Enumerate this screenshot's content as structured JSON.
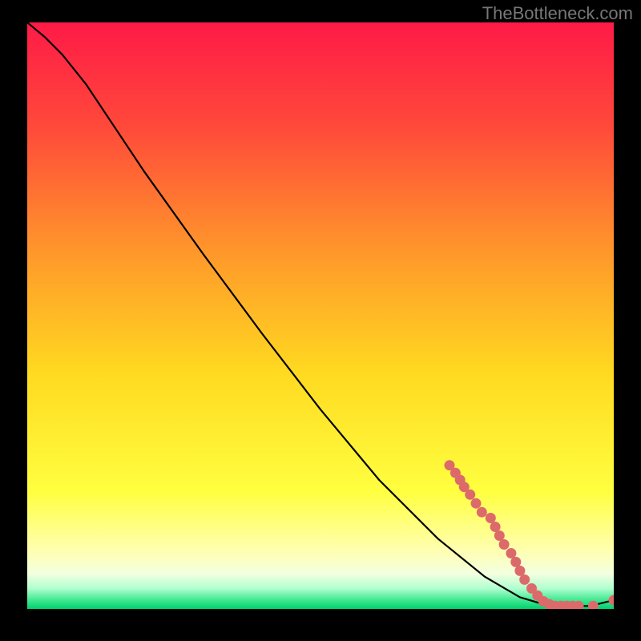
{
  "watermark": "TheBottleneck.com",
  "chart_data": {
    "type": "line",
    "xlim": [
      0,
      100
    ],
    "ylim": [
      0,
      100
    ],
    "background": {
      "type": "vertical-gradient",
      "stops": [
        {
          "pos": 0.0,
          "color": "#ff1a47"
        },
        {
          "pos": 0.18,
          "color": "#ff4a3a"
        },
        {
          "pos": 0.4,
          "color": "#ff9a2a"
        },
        {
          "pos": 0.6,
          "color": "#ffda20"
        },
        {
          "pos": 0.8,
          "color": "#ffff40"
        },
        {
          "pos": 0.9,
          "color": "#ffffb0"
        },
        {
          "pos": 0.94,
          "color": "#f3ffe0"
        },
        {
          "pos": 0.965,
          "color": "#b0ffd0"
        },
        {
          "pos": 0.985,
          "color": "#40e890"
        },
        {
          "pos": 1.0,
          "color": "#00d070"
        }
      ]
    },
    "curve": [
      {
        "x": 0.0,
        "y": 100.0
      },
      {
        "x": 3.0,
        "y": 97.5
      },
      {
        "x": 6.0,
        "y": 94.5
      },
      {
        "x": 10.0,
        "y": 89.5
      },
      {
        "x": 15.0,
        "y": 82.0
      },
      {
        "x": 20.0,
        "y": 74.5
      },
      {
        "x": 30.0,
        "y": 60.5
      },
      {
        "x": 40.0,
        "y": 47.0
      },
      {
        "x": 50.0,
        "y": 34.0
      },
      {
        "x": 60.0,
        "y": 22.0
      },
      {
        "x": 70.0,
        "y": 12.0
      },
      {
        "x": 78.0,
        "y": 5.5
      },
      {
        "x": 84.0,
        "y": 2.0
      },
      {
        "x": 88.0,
        "y": 0.8
      },
      {
        "x": 92.0,
        "y": 0.5
      },
      {
        "x": 96.0,
        "y": 0.5
      },
      {
        "x": 100.0,
        "y": 1.5
      }
    ],
    "markers": [
      {
        "x": 72.0,
        "y": 24.5
      },
      {
        "x": 73.0,
        "y": 23.2
      },
      {
        "x": 73.8,
        "y": 22.0
      },
      {
        "x": 74.5,
        "y": 20.8
      },
      {
        "x": 75.5,
        "y": 19.5
      },
      {
        "x": 76.5,
        "y": 18.0
      },
      {
        "x": 77.5,
        "y": 16.5
      },
      {
        "x": 79.0,
        "y": 15.5
      },
      {
        "x": 79.8,
        "y": 14.0
      },
      {
        "x": 80.5,
        "y": 12.5
      },
      {
        "x": 81.3,
        "y": 11.0
      },
      {
        "x": 82.5,
        "y": 9.5
      },
      {
        "x": 83.3,
        "y": 8.0
      },
      {
        "x": 84.0,
        "y": 6.5
      },
      {
        "x": 84.8,
        "y": 5.0
      },
      {
        "x": 86.0,
        "y": 3.5
      },
      {
        "x": 87.0,
        "y": 2.3
      },
      {
        "x": 88.0,
        "y": 1.3
      },
      {
        "x": 89.0,
        "y": 0.8
      },
      {
        "x": 90.0,
        "y": 0.5
      },
      {
        "x": 91.0,
        "y": 0.5
      },
      {
        "x": 92.0,
        "y": 0.5
      },
      {
        "x": 93.0,
        "y": 0.5
      },
      {
        "x": 94.0,
        "y": 0.5
      },
      {
        "x": 96.5,
        "y": 0.5
      },
      {
        "x": 100.0,
        "y": 1.5
      }
    ],
    "marker_color": "#dd6a6a",
    "curve_color": "#000000"
  }
}
